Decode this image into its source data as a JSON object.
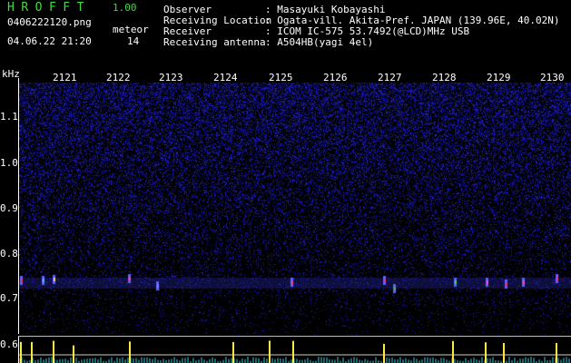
{
  "header": {
    "app_name": "HROFFT",
    "app_version": "1.00",
    "file_name": "0406222120.png",
    "datetime": "04.06.22 21:20",
    "meteor_label": "meteor",
    "meteor_count": "14"
  },
  "station_info": [
    {
      "label": "Observer",
      "value": ": Masayuki Kobayashi"
    },
    {
      "label": "Receiving Location",
      "value": ": Ogata-vill. Akita-Pref. JAPAN (139.96E, 40.02N)"
    },
    {
      "label": "Receiver",
      "value": ": ICOM IC-575 53.7492(@LCD)MHz USB"
    },
    {
      "label": "Receiving antenna",
      "value": ": A504HB(yagi 4el)"
    }
  ],
  "spectrogram": {
    "unit_label": "kHz",
    "time_labels": [
      "2121",
      "2122",
      "2123",
      "2124",
      "2125",
      "2126",
      "2127",
      "2128",
      "2129",
      "2130"
    ],
    "freq_ticks": [
      "1.1",
      "1.0",
      "0.9",
      "0.8",
      "0.7"
    ],
    "lower_panel_tick": "0.6",
    "colors": {
      "background": "#000000",
      "noise": "#1e1ec8",
      "echo_hot": "#ff3030",
      "echo_warm": "#ffdc32",
      "axis": "#ffffff"
    }
  }
}
